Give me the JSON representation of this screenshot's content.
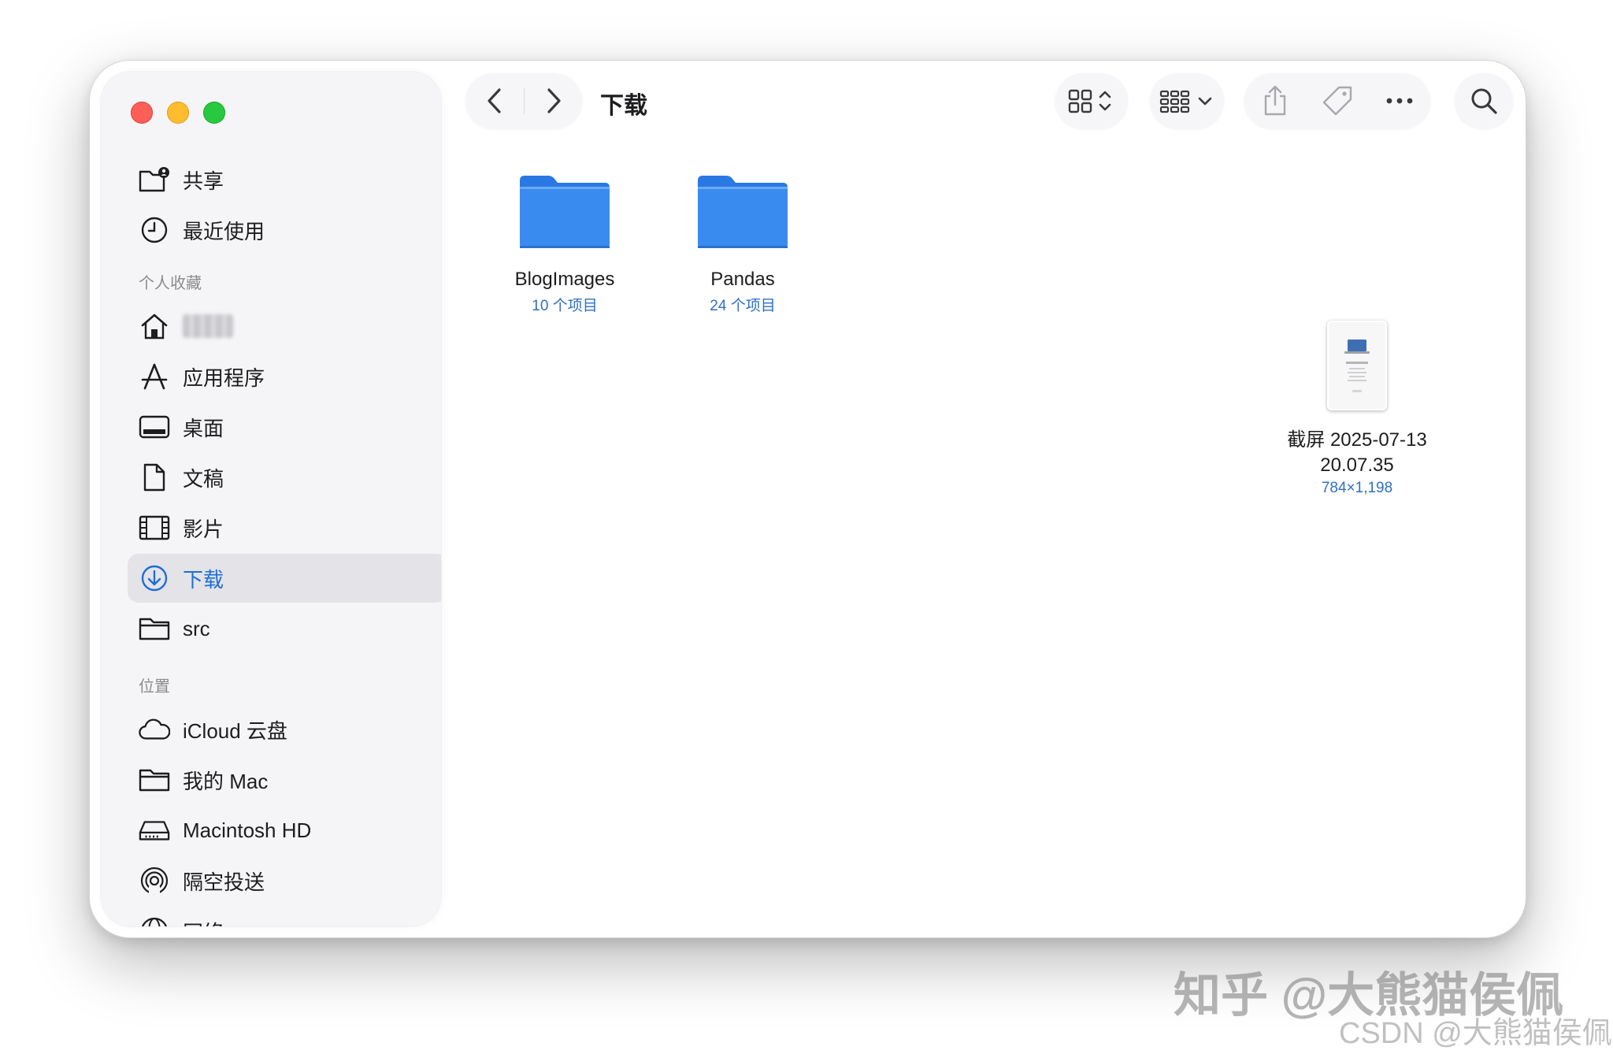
{
  "window": {
    "title": "下载"
  },
  "sidebar": {
    "items_top": [
      {
        "label": "共享",
        "icon": "shared-folder-icon"
      },
      {
        "label": "最近使用",
        "icon": "clock-icon"
      }
    ],
    "favorites_header": "个人收藏",
    "favorites": [
      {
        "label": "",
        "icon": "home-icon"
      },
      {
        "label": "应用程序",
        "icon": "applications-icon"
      },
      {
        "label": "桌面",
        "icon": "desktop-icon"
      },
      {
        "label": "文稿",
        "icon": "document-icon"
      },
      {
        "label": "影片",
        "icon": "film-icon"
      },
      {
        "label": "下载",
        "icon": "download-icon",
        "selected": true
      },
      {
        "label": "src",
        "icon": "folder-icon"
      }
    ],
    "locations_header": "位置",
    "locations": [
      {
        "label": "iCloud 云盘",
        "icon": "cloud-icon"
      },
      {
        "label": "我的 Mac",
        "icon": "folder-icon"
      },
      {
        "label": "Macintosh HD",
        "icon": "disk-icon"
      },
      {
        "label": "隔空投送",
        "icon": "airdrop-icon"
      },
      {
        "label": "网络",
        "icon": "network-icon"
      }
    ]
  },
  "toolbar": {
    "back_icon": "chevron-left-icon",
    "forward_icon": "chevron-right-icon",
    "view_icon": "grid-view-icon",
    "group_icon": "group-icon",
    "share_icon": "share-icon",
    "tag_icon": "tag-icon",
    "more_icon": "more-icon",
    "search_icon": "search-icon"
  },
  "files": [
    {
      "name": "BlogImages",
      "meta": "10 个项目",
      "type": "folder"
    },
    {
      "name": "Pandas",
      "meta": "24 个项目",
      "type": "folder"
    },
    {
      "name_line1": "截屏 2025-07-13",
      "name_line2": "20.07.35",
      "meta": "784×1,198",
      "type": "screenshot"
    }
  ],
  "watermarks": {
    "line1": "知乎 @大熊猫侯佩",
    "line2": "CSDN @大熊猫侯佩"
  },
  "colors": {
    "accent": "#1f6ed4",
    "folder_blue": "#3a8bf0",
    "close": "#ff5f57",
    "minimize": "#febc2e",
    "zoom": "#28c840"
  }
}
